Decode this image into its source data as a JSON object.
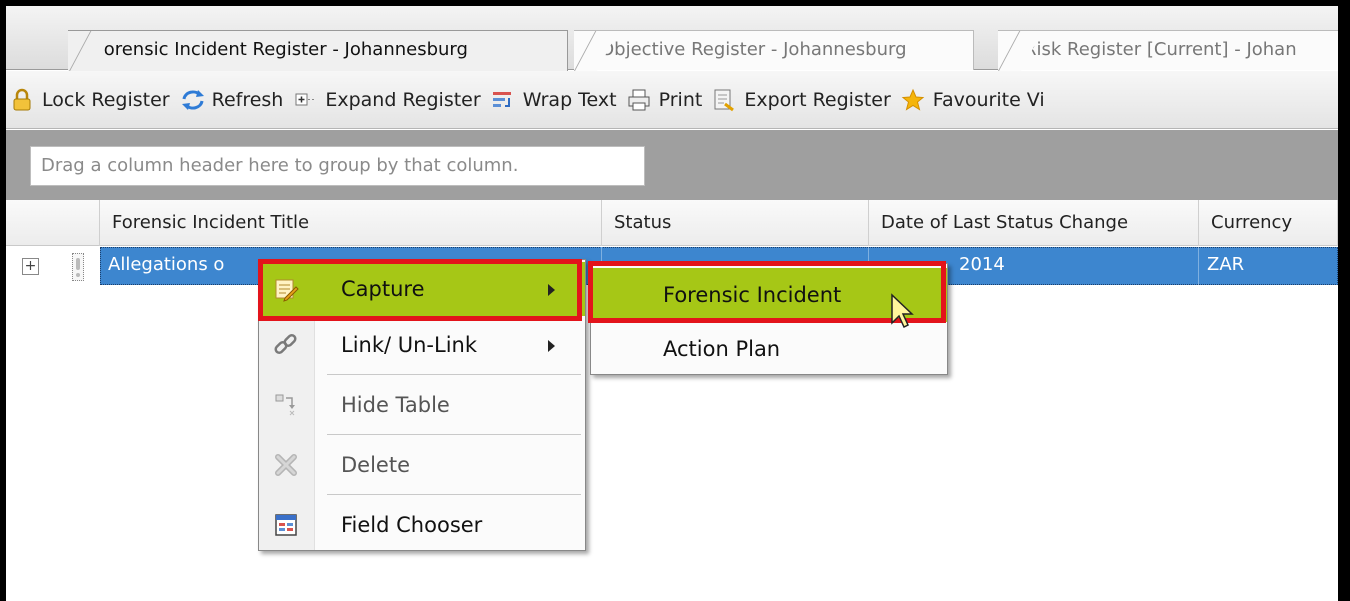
{
  "tabs": [
    {
      "label": "Forensic Incident Register - Johannesburg",
      "active": true
    },
    {
      "label": "Objective Register - Johannesburg",
      "active": false
    },
    {
      "label": "Risk Register [Current] - Johan",
      "active": false
    }
  ],
  "toolbar": {
    "lock": "Lock Register",
    "refresh": "Refresh",
    "expand": "Expand Register",
    "wrap": "Wrap Text",
    "print": "Print",
    "export": "Export Register",
    "favourite": "Favourite Vi"
  },
  "grid": {
    "group_hint": "Drag a column header here to group by that column.",
    "columns": [
      "Forensic Incident Title",
      "Status",
      "Date of Last Status Change",
      "Currency"
    ],
    "row": {
      "expander": "+",
      "title": "Allegations o",
      "date": "2014",
      "currency": "ZAR"
    }
  },
  "context_menu": {
    "items": [
      {
        "label": "Capture",
        "icon": "capture-icon",
        "submenu": true,
        "highlighted": true
      },
      {
        "label": "Link/ Un-Link",
        "icon": "link-icon",
        "submenu": true
      },
      {
        "label": "Hide Table",
        "icon": "hide-table-icon",
        "disabled": true
      },
      {
        "label": "Delete",
        "icon": "delete-icon",
        "disabled": true
      },
      {
        "label": "Field Chooser",
        "icon": "field-chooser-icon"
      }
    ]
  },
  "submenu": {
    "items": [
      {
        "label": "Forensic Incident",
        "highlighted": true
      },
      {
        "label": "Action Plan"
      }
    ]
  },
  "colors": {
    "selection": "#3d86cf",
    "menu_highlight": "#a6c716",
    "callout_red": "#e3141b"
  }
}
